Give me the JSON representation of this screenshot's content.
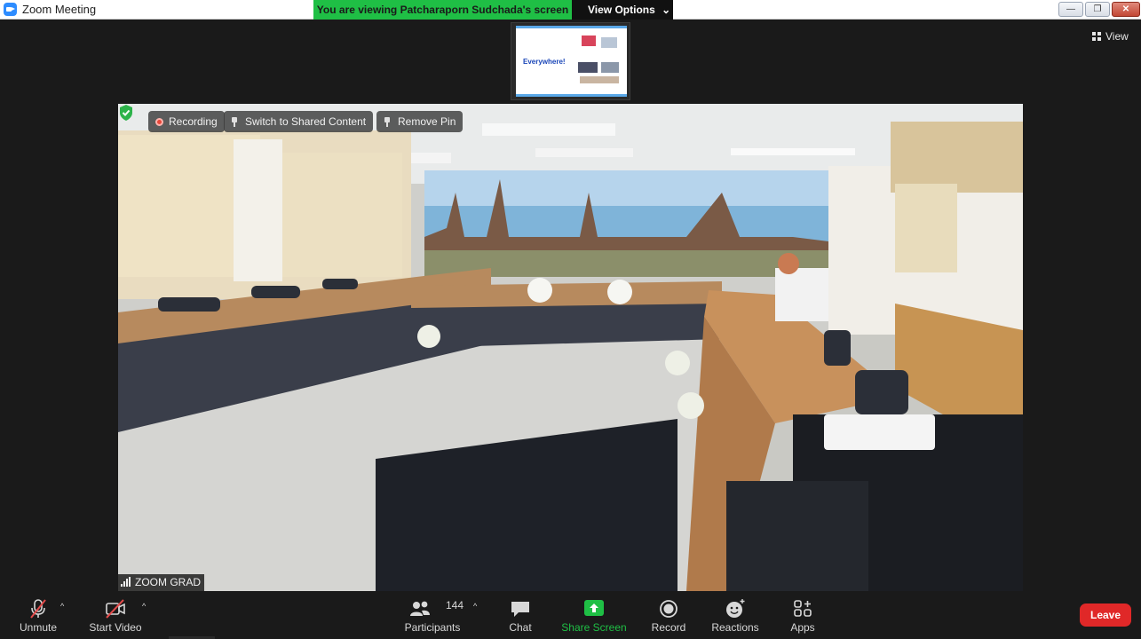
{
  "window": {
    "title": "Zoom Meeting",
    "controls": {
      "minimize": "—",
      "maximize": "❐",
      "close": "✕"
    }
  },
  "share_banner": {
    "message": "You are viewing Patcharaporn Sudchada's screen",
    "options_label": "View Options",
    "options_caret": "⌄"
  },
  "view_button": {
    "label": "View"
  },
  "shared_thumbnail": {
    "slide_text": "Everywhere!"
  },
  "video": {
    "overlay": {
      "recording_label": "Recording",
      "switch_label": "Switch to Shared Content",
      "remove_pin_label": "Remove Pin"
    },
    "participant_name": "ZOOM GRAD"
  },
  "toolbar": {
    "unmute_label": "Unmute",
    "start_video_label": "Start Video",
    "participants_label": "Participants",
    "participants_count": "144",
    "chat_label": "Chat",
    "share_screen_label": "Share Screen",
    "record_label": "Record",
    "reactions_label": "Reactions",
    "apps_label": "Apps",
    "leave_label": "Leave",
    "caret": "^"
  },
  "colors": {
    "share_green": "#1fbf45",
    "leave_red": "#e02828",
    "muted_red": "#e34b4b",
    "toolbar_bg": "#1a1a1a"
  }
}
